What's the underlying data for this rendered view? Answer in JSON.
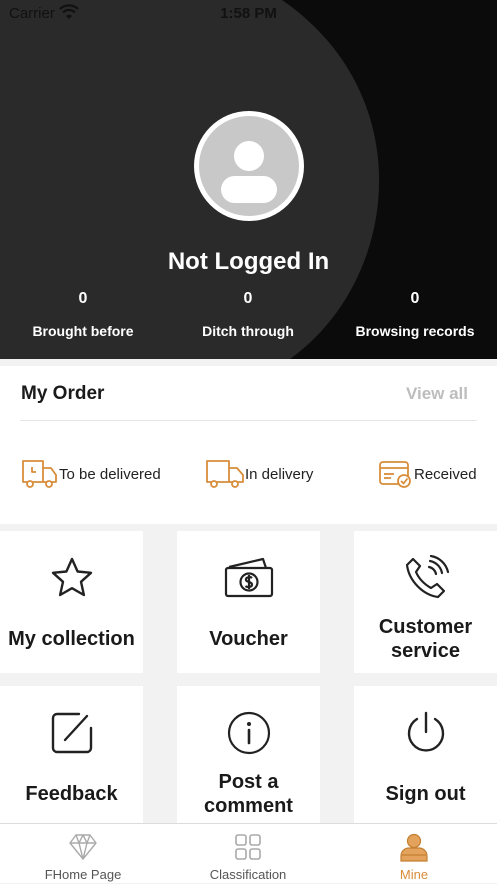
{
  "status_bar": {
    "carrier": "Carrier",
    "time": "1:58 PM"
  },
  "profile": {
    "login_status": "Not Logged In",
    "stats": [
      {
        "value": "0",
        "label": "Brought before"
      },
      {
        "value": "0",
        "label": "Ditch through"
      },
      {
        "value": "0",
        "label": "Browsing records"
      }
    ]
  },
  "orders": {
    "title": "My Order",
    "view_all": "View all",
    "items": [
      {
        "label": "To be delivered",
        "icon": "truck-icon"
      },
      {
        "label": "In delivery",
        "icon": "delivery-truck-icon"
      },
      {
        "label": "Received",
        "icon": "card-check-icon"
      }
    ]
  },
  "menu": [
    {
      "label": "My collection",
      "icon": "star-icon"
    },
    {
      "label": "Voucher",
      "icon": "money-icon"
    },
    {
      "label": "Customer service",
      "icon": "phone-icon"
    },
    {
      "label": "Feedback",
      "icon": "edit-icon"
    },
    {
      "label": "Post a comment",
      "icon": "info-icon"
    },
    {
      "label": "Sign out",
      "icon": "power-icon"
    }
  ],
  "tabbar": {
    "tabs": [
      {
        "label": "FHome Page",
        "icon": "diamond-icon"
      },
      {
        "label": "Classification",
        "icon": "grid-icon"
      },
      {
        "label": "Mine",
        "icon": "person-icon",
        "active": true
      }
    ]
  },
  "colors": {
    "accent": "#d88d3a",
    "header_bg": "#0b0b0b",
    "header_curve": "#2a2a2a"
  }
}
